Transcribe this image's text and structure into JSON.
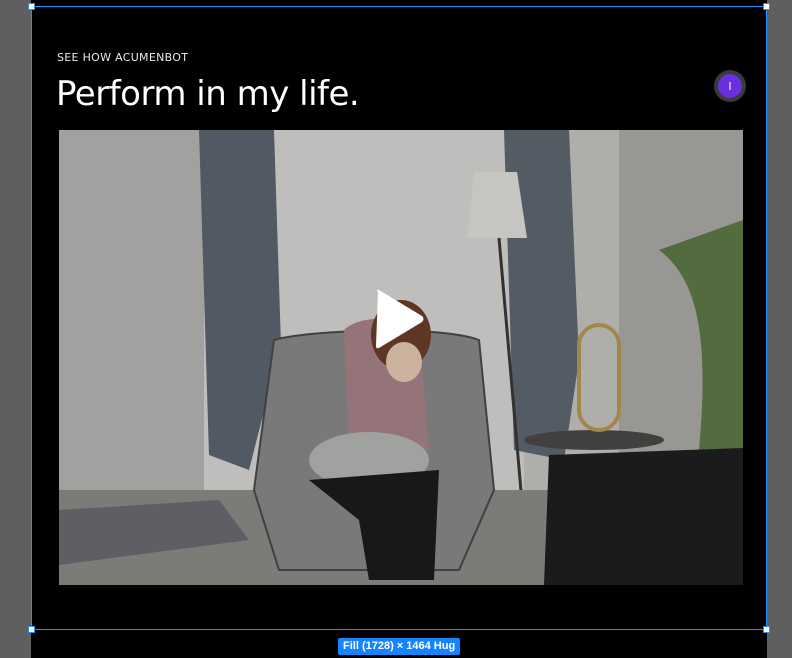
{
  "section": {
    "eyebrow": "SEE HOW ACUMENBOT",
    "headline": "Perform in my life."
  },
  "avatar": {
    "initial": "I",
    "color": "#6a2fe0"
  },
  "video": {
    "state": "paused",
    "play_icon": "play-icon"
  },
  "selection": {
    "dimension_label": "Fill (1728) × 1464 Hug",
    "color": "#1e90ff"
  }
}
